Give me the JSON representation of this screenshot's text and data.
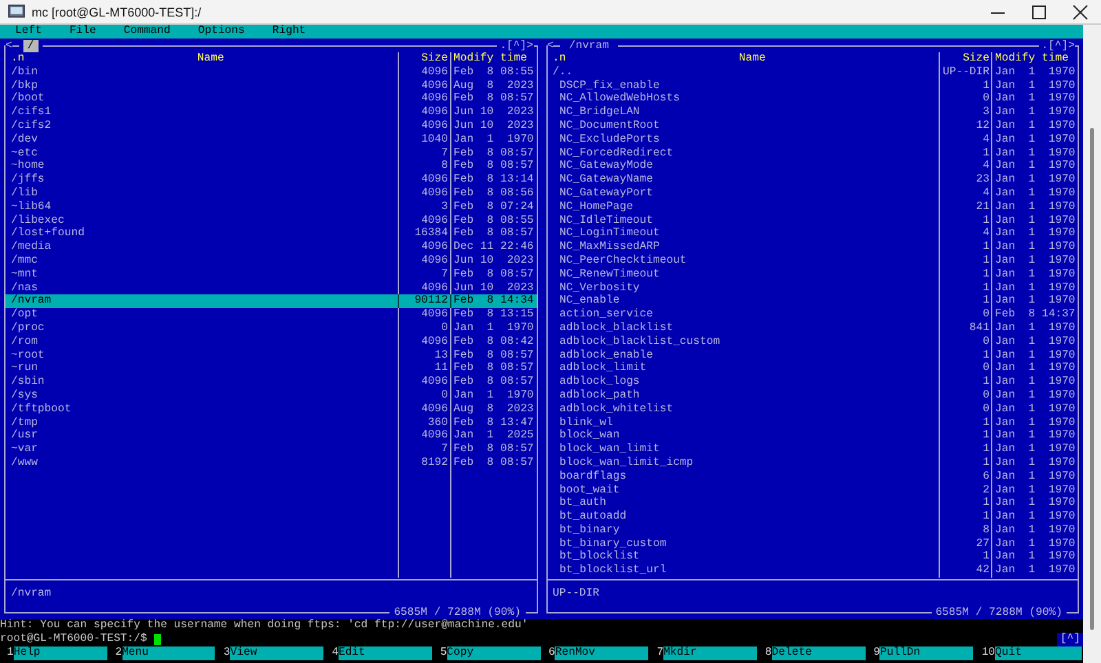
{
  "window": {
    "title": "mc [root@GL-MT6000-TEST]:/"
  },
  "menu": [
    "Left",
    "File",
    "Command",
    "Options",
    "Right"
  ],
  "panels": [
    {
      "path": "/",
      "active": true,
      "back": "<",
      "history": ".[^]>",
      "columns": [
        ".n",
        "Name",
        "Size",
        "Modify time"
      ],
      "mini_status": "/nvram",
      "disk": "6585M / 7288M (90%)",
      "rows": [
        {
          "name": "/bin",
          "size": "4096",
          "date": "Feb  8 08:55",
          "selected": false,
          "kind": "dir"
        },
        {
          "name": "/bkp",
          "size": "4096",
          "date": "Aug  8  2023",
          "selected": false,
          "kind": "dir"
        },
        {
          "name": "/boot",
          "size": "4096",
          "date": "Feb  8 08:57",
          "selected": false,
          "kind": "dir"
        },
        {
          "name": "/cifs1",
          "size": "4096",
          "date": "Jun 10  2023",
          "selected": false,
          "kind": "dir"
        },
        {
          "name": "/cifs2",
          "size": "4096",
          "date": "Jun 10  2023",
          "selected": false,
          "kind": "dir"
        },
        {
          "name": "/dev",
          "size": "1040",
          "date": "Jan  1  1970",
          "selected": false,
          "kind": "dir"
        },
        {
          "name": "~etc",
          "size": "7",
          "date": "Feb  8 08:57",
          "selected": false,
          "kind": "dir"
        },
        {
          "name": "~home",
          "size": "8",
          "date": "Feb  8 08:57",
          "selected": false,
          "kind": "dir"
        },
        {
          "name": "/jffs",
          "size": "4096",
          "date": "Feb  8 13:14",
          "selected": false,
          "kind": "dir"
        },
        {
          "name": "/lib",
          "size": "4096",
          "date": "Feb  8 08:56",
          "selected": false,
          "kind": "dir"
        },
        {
          "name": "~lib64",
          "size": "3",
          "date": "Feb  8 07:24",
          "selected": false,
          "kind": "dir"
        },
        {
          "name": "/libexec",
          "size": "4096",
          "date": "Feb  8 08:55",
          "selected": false,
          "kind": "dir"
        },
        {
          "name": "/lost+found",
          "size": "16384",
          "date": "Feb  8 08:57",
          "selected": false,
          "kind": "dir"
        },
        {
          "name": "/media",
          "size": "4096",
          "date": "Dec 11 22:46",
          "selected": false,
          "kind": "dir"
        },
        {
          "name": "/mmc",
          "size": "4096",
          "date": "Jun 10  2023",
          "selected": false,
          "kind": "dir"
        },
        {
          "name": "~mnt",
          "size": "7",
          "date": "Feb  8 08:57",
          "selected": false,
          "kind": "dir"
        },
        {
          "name": "/nas",
          "size": "4096",
          "date": "Jun 10  2023",
          "selected": false,
          "kind": "dir"
        },
        {
          "name": "/nvram",
          "size": "90112",
          "date": "Feb  8 14:34",
          "selected": true,
          "kind": "dir"
        },
        {
          "name": "/opt",
          "size": "4096",
          "date": "Feb  8 13:15",
          "selected": false,
          "kind": "dir"
        },
        {
          "name": "/proc",
          "size": "0",
          "date": "Jan  1  1970",
          "selected": false,
          "kind": "dir"
        },
        {
          "name": "/rom",
          "size": "4096",
          "date": "Feb  8 08:42",
          "selected": false,
          "kind": "dir"
        },
        {
          "name": "~root",
          "size": "13",
          "date": "Feb  8 08:57",
          "selected": false,
          "kind": "dir"
        },
        {
          "name": "~run",
          "size": "11",
          "date": "Feb  8 08:57",
          "selected": false,
          "kind": "dir"
        },
        {
          "name": "/sbin",
          "size": "4096",
          "date": "Feb  8 08:57",
          "selected": false,
          "kind": "dir"
        },
        {
          "name": "/sys",
          "size": "0",
          "date": "Jan  1  1970",
          "selected": false,
          "kind": "dir"
        },
        {
          "name": "/tftpboot",
          "size": "4096",
          "date": "Aug  8  2023",
          "selected": false,
          "kind": "dir"
        },
        {
          "name": "/tmp",
          "size": "360",
          "date": "Feb  8 13:47",
          "selected": false,
          "kind": "dir"
        },
        {
          "name": "/usr",
          "size": "4096",
          "date": "Jan  1  2025",
          "selected": false,
          "kind": "dir"
        },
        {
          "name": "~var",
          "size": "7",
          "date": "Feb  8 08:57",
          "selected": false,
          "kind": "dir"
        },
        {
          "name": "/www",
          "size": "8192",
          "date": "Feb  8 08:57",
          "selected": false,
          "kind": "dir"
        }
      ]
    },
    {
      "path": "/nvram",
      "active": false,
      "back": "<",
      "history": ".[^]>",
      "columns": [
        ".n",
        "Name",
        "Size",
        "Modify time"
      ],
      "mini_status": "UP--DIR",
      "disk": "6585M / 7288M (90%)",
      "rows": [
        {
          "name": "/..",
          "size": "UP--DIR",
          "date": "Jan  1  1970",
          "selected": false,
          "kind": "dir"
        },
        {
          "name": "DSCP_fix_enable",
          "size": "1",
          "date": "Jan  1  1970",
          "selected": false,
          "kind": "file"
        },
        {
          "name": "NC_AllowedWebHosts",
          "size": "0",
          "date": "Jan  1  1970",
          "selected": false,
          "kind": "file"
        },
        {
          "name": "NC_BridgeLAN",
          "size": "3",
          "date": "Jan  1  1970",
          "selected": false,
          "kind": "file"
        },
        {
          "name": "NC_DocumentRoot",
          "size": "12",
          "date": "Jan  1  1970",
          "selected": false,
          "kind": "file"
        },
        {
          "name": "NC_ExcludePorts",
          "size": "4",
          "date": "Jan  1  1970",
          "selected": false,
          "kind": "file"
        },
        {
          "name": "NC_ForcedRedirect",
          "size": "1",
          "date": "Jan  1  1970",
          "selected": false,
          "kind": "file"
        },
        {
          "name": "NC_GatewayMode",
          "size": "4",
          "date": "Jan  1  1970",
          "selected": false,
          "kind": "file"
        },
        {
          "name": "NC_GatewayName",
          "size": "23",
          "date": "Jan  1  1970",
          "selected": false,
          "kind": "file"
        },
        {
          "name": "NC_GatewayPort",
          "size": "4",
          "date": "Jan  1  1970",
          "selected": false,
          "kind": "file"
        },
        {
          "name": "NC_HomePage",
          "size": "21",
          "date": "Jan  1  1970",
          "selected": false,
          "kind": "file"
        },
        {
          "name": "NC_IdleTimeout",
          "size": "1",
          "date": "Jan  1  1970",
          "selected": false,
          "kind": "file"
        },
        {
          "name": "NC_LoginTimeout",
          "size": "4",
          "date": "Jan  1  1970",
          "selected": false,
          "kind": "file"
        },
        {
          "name": "NC_MaxMissedARP",
          "size": "1",
          "date": "Jan  1  1970",
          "selected": false,
          "kind": "file"
        },
        {
          "name": "NC_PeerChecktimeout",
          "size": "1",
          "date": "Jan  1  1970",
          "selected": false,
          "kind": "file"
        },
        {
          "name": "NC_RenewTimeout",
          "size": "1",
          "date": "Jan  1  1970",
          "selected": false,
          "kind": "file"
        },
        {
          "name": "NC_Verbosity",
          "size": "1",
          "date": "Jan  1  1970",
          "selected": false,
          "kind": "file"
        },
        {
          "name": "NC_enable",
          "size": "1",
          "date": "Jan  1  1970",
          "selected": false,
          "kind": "file"
        },
        {
          "name": "action_service",
          "size": "0",
          "date": "Feb  8 14:37",
          "selected": false,
          "kind": "file"
        },
        {
          "name": "adblock_blacklist",
          "size": "841",
          "date": "Jan  1  1970",
          "selected": false,
          "kind": "file"
        },
        {
          "name": "adblock_blacklist_custom",
          "size": "0",
          "date": "Jan  1  1970",
          "selected": false,
          "kind": "file"
        },
        {
          "name": "adblock_enable",
          "size": "1",
          "date": "Jan  1  1970",
          "selected": false,
          "kind": "file"
        },
        {
          "name": "adblock_limit",
          "size": "0",
          "date": "Jan  1  1970",
          "selected": false,
          "kind": "file"
        },
        {
          "name": "adblock_logs",
          "size": "1",
          "date": "Jan  1  1970",
          "selected": false,
          "kind": "file"
        },
        {
          "name": "adblock_path",
          "size": "0",
          "date": "Jan  1  1970",
          "selected": false,
          "kind": "file"
        },
        {
          "name": "adblock_whitelist",
          "size": "0",
          "date": "Jan  1  1970",
          "selected": false,
          "kind": "file"
        },
        {
          "name": "blink_wl",
          "size": "1",
          "date": "Jan  1  1970",
          "selected": false,
          "kind": "file"
        },
        {
          "name": "block_wan",
          "size": "1",
          "date": "Jan  1  1970",
          "selected": false,
          "kind": "file"
        },
        {
          "name": "block_wan_limit",
          "size": "1",
          "date": "Jan  1  1970",
          "selected": false,
          "kind": "file"
        },
        {
          "name": "block_wan_limit_icmp",
          "size": "1",
          "date": "Jan  1  1970",
          "selected": false,
          "kind": "file"
        },
        {
          "name": "boardflags",
          "size": "6",
          "date": "Jan  1  1970",
          "selected": false,
          "kind": "file"
        },
        {
          "name": "boot_wait",
          "size": "2",
          "date": "Jan  1  1970",
          "selected": false,
          "kind": "file"
        },
        {
          "name": "bt_auth",
          "size": "1",
          "date": "Jan  1  1970",
          "selected": false,
          "kind": "file"
        },
        {
          "name": "bt_autoadd",
          "size": "1",
          "date": "Jan  1  1970",
          "selected": false,
          "kind": "file"
        },
        {
          "name": "bt_binary",
          "size": "8",
          "date": "Jan  1  1970",
          "selected": false,
          "kind": "file"
        },
        {
          "name": "bt_binary_custom",
          "size": "27",
          "date": "Jan  1  1970",
          "selected": false,
          "kind": "file"
        },
        {
          "name": "bt_blocklist",
          "size": "1",
          "date": "Jan  1  1970",
          "selected": false,
          "kind": "file"
        },
        {
          "name": "bt_blocklist_url",
          "size": "42",
          "date": "Jan  1  1970",
          "selected": false,
          "kind": "file"
        }
      ]
    }
  ],
  "hint": "Hint: You can specify the username when doing ftps: 'cd ftp://user@machine.edu'",
  "prompt": "root@GL-MT6000-TEST:/$",
  "history_button": "[^]",
  "function_keys": [
    {
      "number": "1",
      "label": "Help"
    },
    {
      "number": "2",
      "label": "Menu"
    },
    {
      "number": "3",
      "label": "View"
    },
    {
      "number": "4",
      "label": "Edit"
    },
    {
      "number": "5",
      "label": "Copy"
    },
    {
      "number": "6",
      "label": "RenMov"
    },
    {
      "number": "7",
      "label": "Mkdir"
    },
    {
      "number": "8",
      "label": "Delete"
    },
    {
      "number": "9",
      "label": "PullDn"
    },
    {
      "number": "10",
      "label": "Quit"
    }
  ]
}
